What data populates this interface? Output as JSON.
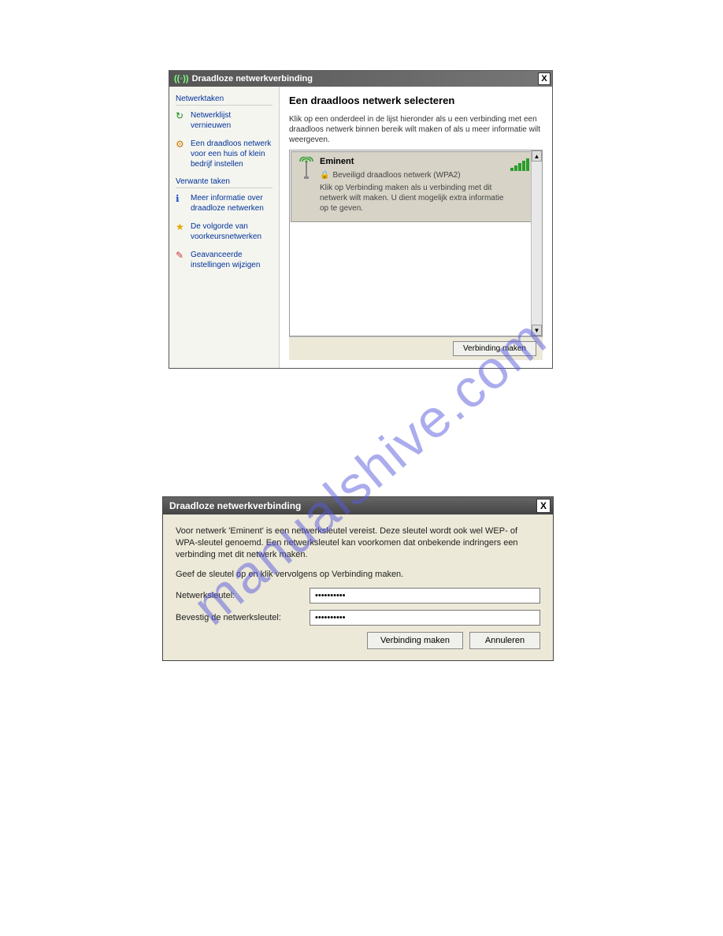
{
  "watermark": "manualshive.com",
  "window1": {
    "title": "Draadloze netwerkverbinding",
    "close": "X",
    "sidebar": {
      "group1_title": "Netwerktaken",
      "items1": [
        {
          "icon": "↻",
          "icon_color": "#1a8a1a",
          "label": "Netwerklijst vernieuwen"
        },
        {
          "icon": "⚙",
          "icon_color": "#cc7a00",
          "label": "Een draadloos netwerk voor een huis of klein bedrijf instellen"
        }
      ],
      "group2_title": "Verwante taken",
      "items2": [
        {
          "icon": "ℹ",
          "icon_color": "#1a4ccc",
          "label": "Meer informatie over draadloze netwerken"
        },
        {
          "icon": "★",
          "icon_color": "#e0a800",
          "label": "De volgorde van voorkeursnetwerken"
        },
        {
          "icon": "✎",
          "icon_color": "#cc3333",
          "label": "Geavanceerde instellingen wijzigen"
        }
      ]
    },
    "main": {
      "heading": "Een draadloos netwerk selecteren",
      "subtext": "Klik op een onderdeel in de lijst hieronder als u een verbinding met een draadloos netwerk binnen bereik wilt maken of als u meer informatie wilt weergeven.",
      "network": {
        "name": "Eminent",
        "security": "Beveiligd draadloos netwerk (WPA2)",
        "desc": "Klik op Verbinding maken als u verbinding met dit netwerk wilt maken. U dient mogelijk extra informatie op te geven."
      }
    },
    "footer_button": "Verbinding maken"
  },
  "window2": {
    "title": "Draadloze netwerkverbinding",
    "close": "X",
    "intro": "Voor netwerk 'Eminent' is een netwerksleutel vereist. Deze sleutel wordt ook wel WEP- of WPA-sleutel genoemd. Een netwerksleutel kan voorkomen dat onbekende indringers een verbinding met dit netwerk maken.",
    "instruction": "Geef de sleutel op en klik vervolgens op Verbinding maken.",
    "label_key": "Netwerksleutel:",
    "label_confirm": "Bevestig de netwerksleutel:",
    "key_value": "••••••••••",
    "confirm_value": "••••••••••",
    "btn_connect": "Verbinding maken",
    "btn_cancel": "Annuleren"
  }
}
